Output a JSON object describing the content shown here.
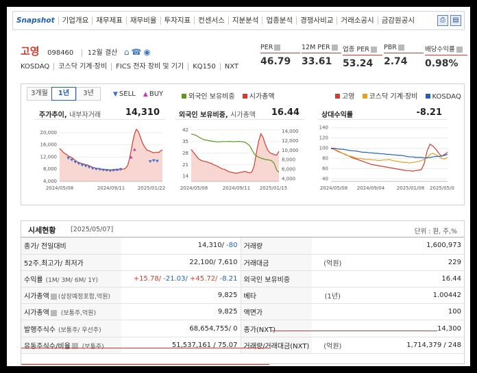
{
  "nav": {
    "items": [
      "Snapshot",
      "기업개요",
      "재무제표",
      "재무비율",
      "투자지표",
      "컨센서스",
      "지분분석",
      "업종분석",
      "경쟁사비교",
      "거래소공시",
      "금감원공시"
    ],
    "print_icon": "printer-icon",
    "export_icon": "export-icon"
  },
  "company": {
    "name": "고영",
    "code": "098460",
    "settle": "12월 결산",
    "market": "KOSDAQ",
    "sector": "코스닥 기계·장비",
    "fics": "FICS 전자 장비 및 기기",
    "index": "KQ150",
    "nxt": "NXT",
    "icons": [
      "home-icon",
      "phone-icon",
      "location-icon"
    ]
  },
  "metrics": [
    {
      "label": "PER",
      "value": "46.79"
    },
    {
      "label": "12M PER",
      "value": "33.61"
    },
    {
      "label": "업종 PER",
      "value": "53.24"
    },
    {
      "label": "PBR",
      "value": "2.74"
    },
    {
      "label": "배당수익률",
      "value": "0.98%"
    }
  ],
  "chart_panel": {
    "tabs": [
      "3개월",
      "1년",
      "3년"
    ],
    "active_tab": "1년",
    "legend_trade": {
      "sell": "SELL",
      "buy": "BUY"
    },
    "legend_foreign": {
      "foreign": "외국인 보유비중",
      "mcap": "시가총액"
    },
    "legend_rel": {
      "company": "고영",
      "sector": "코스닥 기계·장비",
      "index": "KOSDAQ"
    },
    "colors": {
      "red": "#d23b2d",
      "green": "#5a9a1a",
      "orange": "#e8a020",
      "blue": "#1f5fb8",
      "sell": "#3a6fd0",
      "buy": "#c23bb0"
    }
  },
  "chart_data": [
    {
      "type": "area",
      "title": "주가추이",
      "subtitle": "내부자거래",
      "header_value": "14,310",
      "x_ticks": [
        "2024/05/08",
        "2024/09/11",
        "2025/01/22"
      ],
      "y_ticks": [
        20000,
        16000,
        12000,
        8000,
        4000
      ],
      "y_tick_labels": [
        "20,000",
        "16,000",
        "12,000",
        "8,000",
        "4,000"
      ],
      "ylim": [
        4000,
        22000
      ],
      "series": [
        {
          "name": "주가",
          "values": [
            14800,
            14300,
            13600,
            13200,
            12800,
            12300,
            12100,
            11800,
            11400,
            10900,
            10500,
            10200,
            10000,
            9800,
            9700,
            9500,
            9400,
            9100,
            8900,
            8600,
            8500,
            8300,
            8200,
            8000,
            7900,
            7800,
            7800,
            7700,
            7700,
            7700,
            7600,
            7700,
            7800,
            7700,
            7800,
            8000,
            8000,
            8100,
            8400,
            9200,
            11200,
            14000,
            17200,
            19600,
            21100,
            20500,
            19200,
            17500,
            16100,
            15200,
            14300,
            14100,
            13900,
            13600,
            13400,
            13500,
            13600,
            13500,
            14100,
            14310
          ]
        }
      ],
      "sell_markers": [
        [
          5,
          11600
        ],
        [
          7,
          11000
        ],
        [
          9,
          10300
        ],
        [
          11,
          9800
        ],
        [
          13,
          9300
        ],
        [
          15,
          9000
        ],
        [
          17,
          8600
        ],
        [
          19,
          8200
        ],
        [
          21,
          8000
        ],
        [
          23,
          7900
        ],
        [
          25,
          7700
        ],
        [
          27,
          7600
        ],
        [
          29,
          7500
        ],
        [
          31,
          7600
        ],
        [
          33,
          7700
        ],
        [
          35,
          7900
        ],
        [
          52,
          10500
        ],
        [
          54,
          10800
        ],
        [
          56,
          10600
        ]
      ],
      "buy_markers": [
        [
          41,
          12000
        ],
        [
          43,
          14500
        ]
      ]
    },
    {
      "type": "line",
      "title": "외국인 보유비중",
      "subtitle": "시가총액",
      "header_value": "16.44",
      "x_ticks": [
        "2024/05/08",
        "2024/09/11",
        "2025/01/15"
      ],
      "y_left_ticks": [
        42,
        35,
        28,
        21,
        14
      ],
      "y_right_ticks": [
        14000,
        12000,
        10000,
        8000,
        6000,
        4000
      ],
      "y_right_tick_labels": [
        "14,000",
        "12,000",
        "10,000",
        "8,000",
        "6,000",
        "4,000"
      ],
      "ylim_left": [
        11,
        44
      ],
      "ylim_right": [
        3500,
        15000
      ],
      "series": [
        {
          "name": "외국인 보유비중",
          "values": [
            39.5,
            39.2,
            38.8,
            38.0,
            37.2,
            36.5,
            36.0,
            35.8,
            35.5,
            35.3,
            35.1,
            34.9,
            34.8,
            34.9,
            35.0,
            35.0,
            35.0,
            35.1,
            35.0,
            34.9,
            35.0,
            35.1,
            35.0,
            34.8,
            34.5,
            33.6,
            32.5,
            30.0,
            27.6,
            26.4,
            25.6,
            25.0,
            24.6,
            24.2,
            24.0,
            23.8,
            23.2,
            21.5,
            17.8,
            16.44
          ]
        },
        {
          "name": "시가총액",
          "values": [
            10200,
            9600,
            9000,
            8400,
            8000,
            7800,
            7700,
            7600,
            7400,
            7300,
            7000,
            6800,
            6600,
            6300,
            6100,
            6000,
            5700,
            5500,
            5400,
            5300,
            5200,
            5300,
            5400,
            5500,
            5600,
            5400,
            5300,
            5500,
            6800,
            9600,
            12000,
            13500,
            12700,
            11200,
            10100,
            9500,
            9300,
            9100,
            9000,
            9825
          ]
        }
      ]
    },
    {
      "type": "line",
      "title": "상대수익률",
      "header_value": "-8.21",
      "x_ticks": [
        "2024/05/08",
        "2024/09/04",
        "2025/01/08",
        "2025/05/0"
      ],
      "y_ticks": [
        140,
        120,
        100,
        80,
        60,
        40
      ],
      "ylim": [
        35,
        145
      ],
      "series": [
        {
          "name": "고영",
          "values": [
            99,
            98,
            95,
            92,
            90,
            87,
            85,
            82,
            80,
            78,
            76,
            74,
            72,
            70,
            68,
            67,
            66,
            65,
            64,
            63,
            62,
            61,
            60,
            59,
            58,
            57,
            56,
            56,
            55,
            56,
            57,
            58,
            70,
            95,
            108,
            104,
            98,
            90,
            84,
            88,
            92
          ]
        },
        {
          "name": "코스닥 기계·장비",
          "values": [
            100,
            99,
            96,
            93,
            90,
            88,
            85,
            84,
            82,
            80,
            80,
            79,
            78,
            78,
            77,
            77,
            76,
            76,
            77,
            77,
            78,
            76,
            75,
            74,
            73,
            72,
            72,
            71,
            72,
            73,
            74,
            76,
            78,
            82,
            88,
            90,
            87,
            84,
            80,
            79,
            82
          ]
        },
        {
          "name": "KOSDAQ",
          "values": [
            100,
            100,
            99,
            98,
            98,
            97,
            96,
            95,
            95,
            94,
            93,
            92,
            92,
            91,
            91,
            90,
            90,
            89,
            89,
            88,
            88,
            87,
            87,
            86,
            86,
            85,
            84,
            83,
            83,
            82,
            82,
            82,
            81,
            81,
            82,
            83,
            84,
            84,
            85,
            86,
            88
          ]
        }
      ]
    }
  ],
  "market": {
    "title": "시세현황",
    "date": "[2025/05/07]",
    "unit": "단위 : 원, 주,%",
    "rows": [
      {
        "k1": "종가/ 전일대비",
        "k1s": "",
        "v1": "14,310/ -80",
        "k2": "거래량",
        "u2": "",
        "v2": "1,600,973"
      },
      {
        "k1": "52주.최고가/ 최저가",
        "k1s": "",
        "v1": "22,100/ 7,610",
        "k2": "거래대금",
        "u2": "(억원)",
        "v2": "229"
      },
      {
        "k1": "수익률",
        "k1s": "(1M/ 3M/ 6M/ 1Y)",
        "v1": "",
        "k2": "외국인 보유비중",
        "u2": "",
        "v2": "16.44"
      },
      {
        "k1": "시가총액",
        "k1s": "(상장예정포함,억원)",
        "v1": "9,825",
        "k2": "베타",
        "u2": "(1년)",
        "v2": "1.00442"
      },
      {
        "k1": "시가총액",
        "k1s": "(보통주,억원)",
        "v1": "9,825",
        "k2": "액면가",
        "u2": "",
        "v2": "100"
      },
      {
        "k1": "발행주식수",
        "k1s": "(보통주/ 우선주)",
        "v1": "68,654,755/ 0",
        "k2": "종가(NXT)",
        "u2": "",
        "v2": "14,300"
      },
      {
        "k1": "유동주식수/비율",
        "k1s": "(보통주)",
        "v1": "51,537,161 / 75.07",
        "k2": "거래량/거래대금(NXT)",
        "u2": "(억원)",
        "v2": "1,714,379 / 248"
      }
    ],
    "returns": [
      "+15.78/",
      " -21.03/",
      " +45.72/",
      " -8.21"
    ],
    "change_neg": "-80"
  }
}
